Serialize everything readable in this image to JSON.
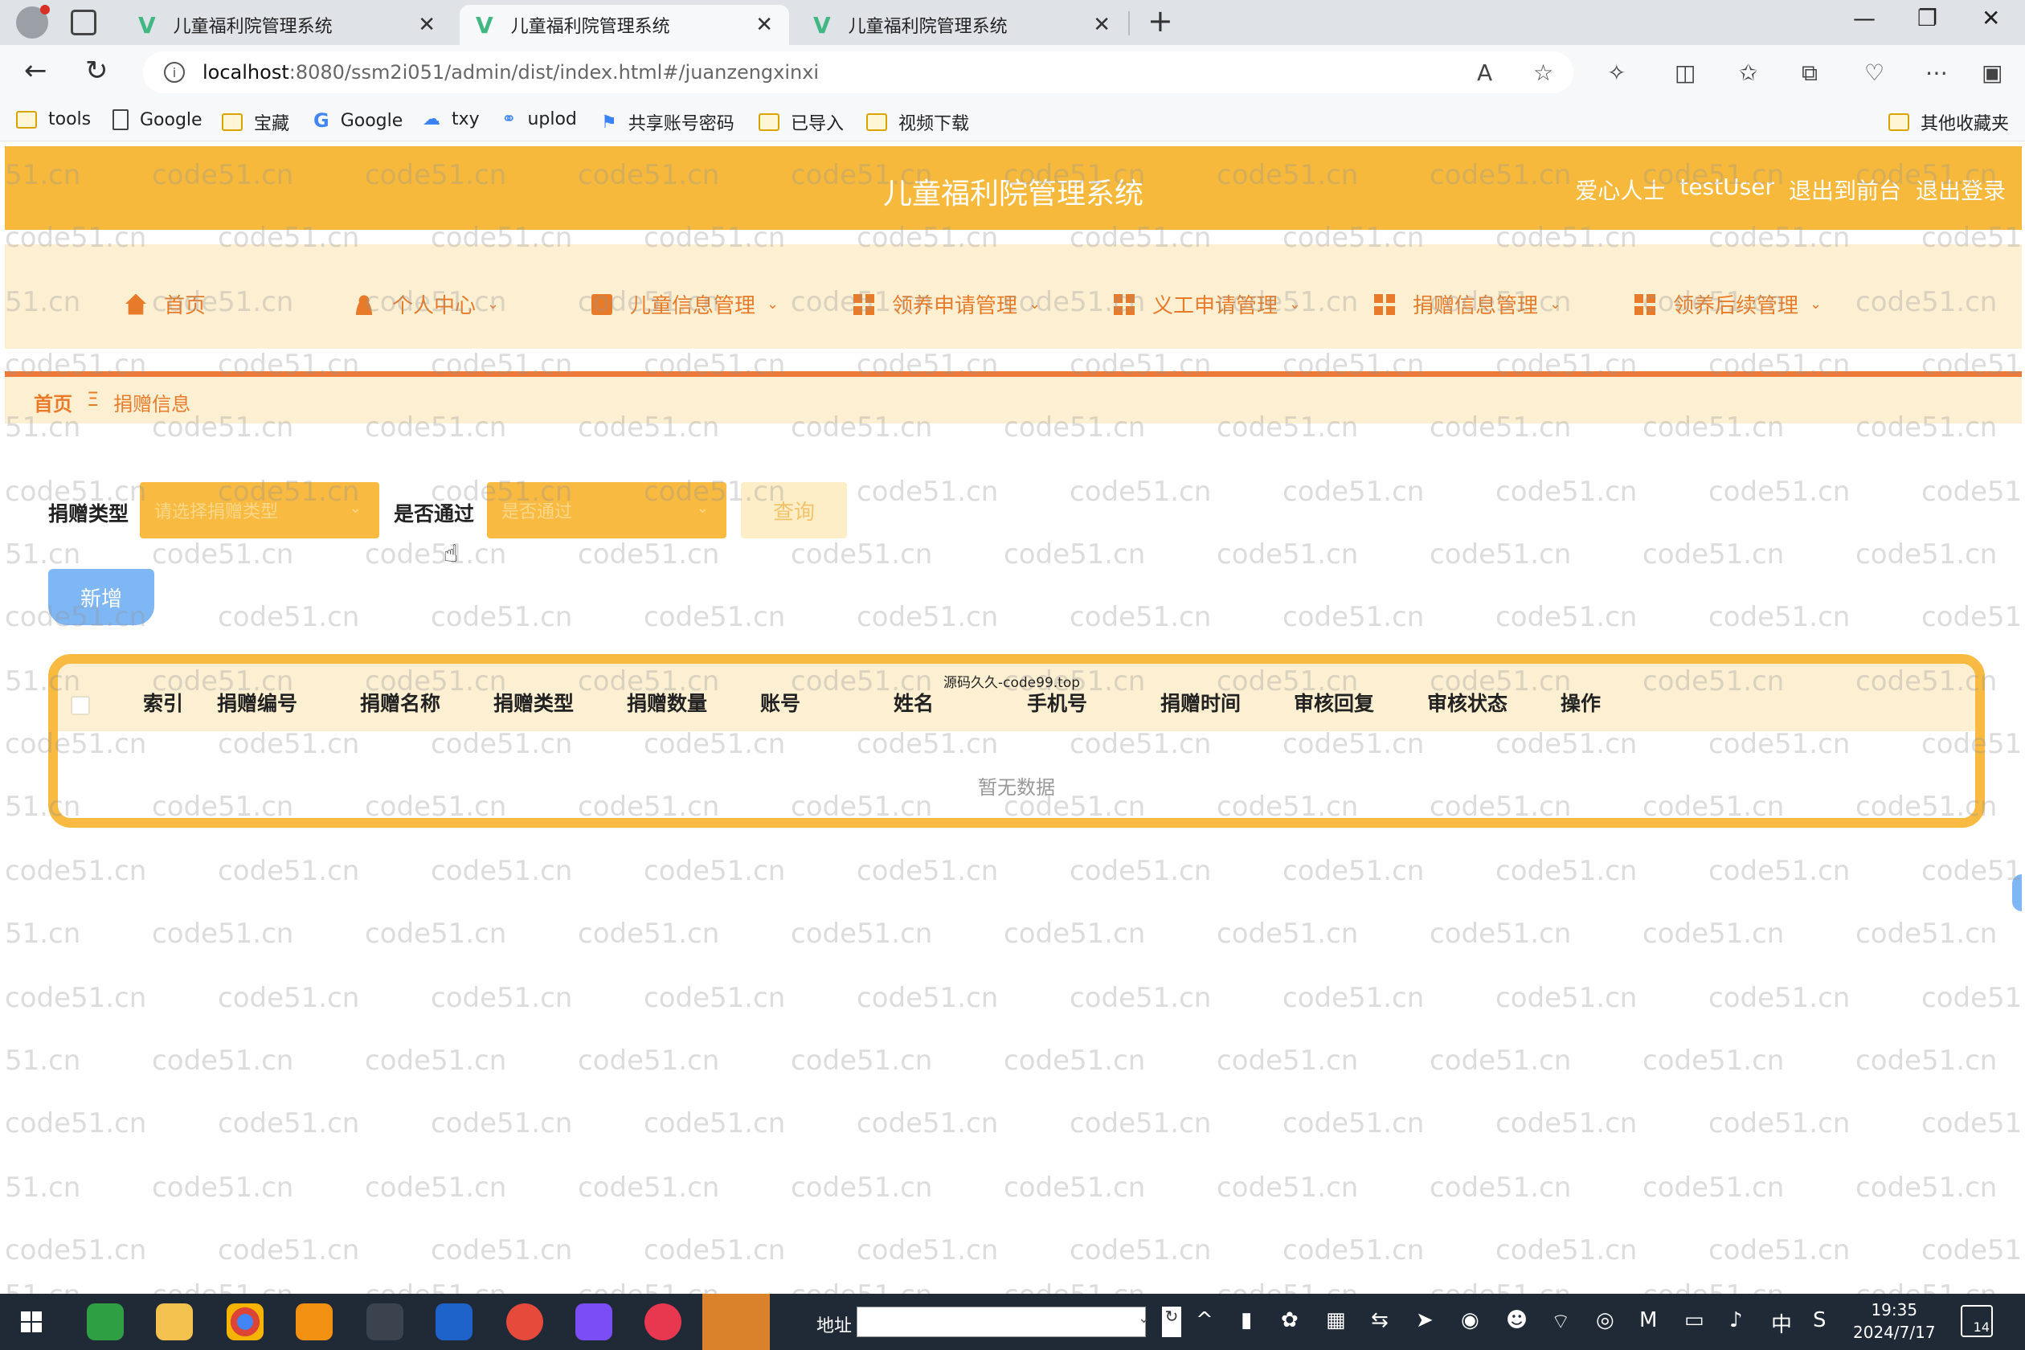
{
  "browser": {
    "tabs": [
      {
        "title": "儿童福利院管理系统",
        "active": false
      },
      {
        "title": "儿童福利院管理系统",
        "active": true
      },
      {
        "title": "儿童福利院管理系统",
        "active": false
      }
    ],
    "url_host": "localhost",
    "url_path": ":8080/ssm2i051/admin/dist/index.html#/juanzengxinxi",
    "bookmarks": [
      "tools",
      "Google",
      "宝藏",
      "Google",
      "txy",
      "uplod",
      "共享账号密码",
      "已导入",
      "视频下载"
    ],
    "other_bookmarks": "其他收藏夹"
  },
  "watermark_text": "code51.cn",
  "header": {
    "title": "儿童福利院管理系统",
    "role": "爱心人士",
    "username": "testUser",
    "to_front": "退出到前台",
    "logout": "退出登录"
  },
  "nav": {
    "items": [
      {
        "label": "首页",
        "icon": "home-icon"
      },
      {
        "label": "个人中心",
        "icon": "user-icon"
      },
      {
        "label": "儿童信息管理",
        "icon": "book-icon"
      },
      {
        "label": "领养申请管理",
        "icon": "grid-icon"
      },
      {
        "label": "义工申请管理",
        "icon": "grid-icon"
      },
      {
        "label": "捐赠信息管理",
        "icon": "grid-icon"
      },
      {
        "label": "领养后续管理",
        "icon": "grid-icon"
      }
    ]
  },
  "breadcrumb": {
    "home": "首页",
    "sep": "Ξ",
    "current": "捐赠信息"
  },
  "search": {
    "type_label": "捐赠类型",
    "type_placeholder": "请选择捐赠类型",
    "pass_label": "是否通过",
    "pass_placeholder": "是否通过",
    "query_button": "查询"
  },
  "add_button": "新增",
  "table": {
    "columns": [
      "索引",
      "捐赠编号",
      "捐赠名称",
      "捐赠类型",
      "捐赠数量",
      "账号",
      "姓名",
      "手机号",
      "捐赠时间",
      "审核回复",
      "审核状态",
      "操作"
    ],
    "empty_text": "暂无数据"
  },
  "overlay_tip": "源码久久-code99.top",
  "taskbar": {
    "address_label": "地址",
    "ime": "中",
    "time": "19:35",
    "date": "2024/7/17",
    "notifications": "14"
  },
  "colors": {
    "primary": "#f6b93b",
    "nav_bg": "#fdf0d2",
    "accent": "#e77b2a",
    "add_button": "#7fb7f5"
  }
}
